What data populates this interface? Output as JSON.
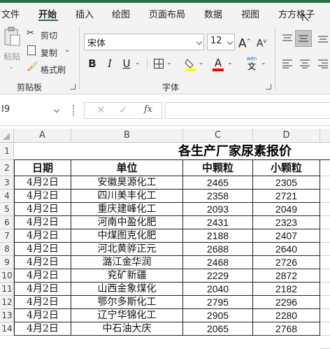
{
  "tabs": [
    "文件",
    "开始",
    "插入",
    "绘图",
    "页面布局",
    "数据",
    "视图",
    "方方格子"
  ],
  "clipboard": {
    "paste": "粘贴",
    "cut": "剪切",
    "copy": "复制",
    "format_painter": "格式刷",
    "group": "剪贴板"
  },
  "font": {
    "name": "宋体",
    "size": "12",
    "bold": "B",
    "italic": "I",
    "underline": "U",
    "grow": "A",
    "shrink": "A",
    "phonetic_top": "wén",
    "phonetic_bottom": "文",
    "group": "字体"
  },
  "formula_bar": {
    "name_box": "I9",
    "fx": "fx"
  },
  "columns": [
    "A",
    "B",
    "C",
    "D"
  ],
  "rows": [
    "1",
    "2",
    "3",
    "4",
    "5",
    "6",
    "7",
    "8",
    "9",
    "10",
    "11",
    "12",
    "13",
    "14"
  ],
  "sheet_title": "各生产厂家尿素报价",
  "headers": [
    "日期",
    "单位",
    "中颗粒",
    "小颗粒"
  ],
  "data_rows": [
    [
      "4月2日",
      "安徽昊源化工",
      "2465",
      "2305"
    ],
    [
      "4月2日",
      "四川美丰化工",
      "2358",
      "2721"
    ],
    [
      "4月2日",
      "重庆建峰化工",
      "2093",
      "2049"
    ],
    [
      "4月2日",
      "河南中盈化肥",
      "2431",
      "2323"
    ],
    [
      "4月2日",
      "中煤图克化肥",
      "2188",
      "2407"
    ],
    [
      "4月2日",
      "河北黄骅正元",
      "2688",
      "2640"
    ],
    [
      "4月2日",
      "潞江金华润",
      "2468",
      "2726"
    ],
    [
      "4月2日",
      "兖矿新疆",
      "2229",
      "2872"
    ],
    [
      "4月2日",
      "山西金象煤化",
      "2040",
      "2182"
    ],
    [
      "4月2日",
      "鄂尔多斯化工",
      "2795",
      "2296"
    ],
    [
      "4月2日",
      "辽宁华锦化工",
      "2905",
      "2280"
    ],
    [
      "4月2日",
      "中石油大庆",
      "2065",
      "2768"
    ]
  ]
}
